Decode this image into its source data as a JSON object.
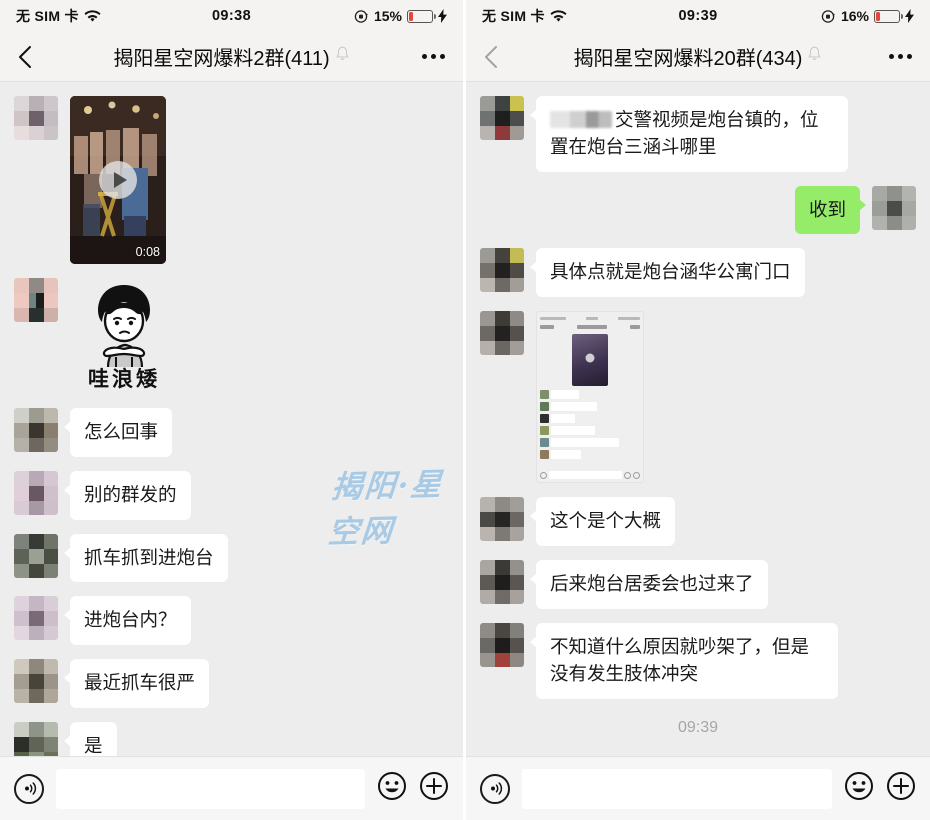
{
  "watermark": "揭阳·星空网",
  "colors": {
    "bubble_out": "#95EC69",
    "bubble_in": "#FFFFFF",
    "chat_bg": "#EDEDED",
    "battery_low": "#E8453C",
    "watermark": "#9DC4E4"
  },
  "panels": [
    {
      "status": {
        "carrier": "无 SIM 卡",
        "wifi_icon": "wifi-icon",
        "time": "09:38",
        "lock_icon": "rotation-lock-icon",
        "battery_percent": "15%",
        "battery_level": 15,
        "charging_icon": "lightning-bolt-icon"
      },
      "nav": {
        "back_icon": "chevron-left-icon",
        "title": "揭阳星空网爆料2群(411)",
        "mute_icon": "bell-muted-icon",
        "more_icon": "more-dots-icon"
      },
      "messages": [
        {
          "type": "video",
          "side": "in",
          "duration": "0:08",
          "play_icon": "play-icon"
        },
        {
          "type": "sticker",
          "side": "in",
          "caption": "哇浪矮",
          "alt": "cartoon-face-sticker"
        },
        {
          "type": "text",
          "side": "in",
          "text": "怎么回事"
        },
        {
          "type": "text",
          "side": "in",
          "text": "别的群发的"
        },
        {
          "type": "text",
          "side": "in",
          "text": "抓车抓到进炮台"
        },
        {
          "type": "text",
          "side": "in",
          "text": "进炮台内？"
        },
        {
          "type": "text",
          "side": "in",
          "text": "最近抓车很严"
        },
        {
          "type": "text",
          "side": "in",
          "text": "是"
        }
      ],
      "input": {
        "voice_icon": "voice-input-icon",
        "value": "",
        "placeholder": "",
        "emoji_icon": "smiley-icon",
        "plus_icon": "plus-icon"
      }
    },
    {
      "status": {
        "carrier": "无 SIM 卡",
        "wifi_icon": "wifi-icon",
        "time": "09:39",
        "lock_icon": "rotation-lock-icon",
        "battery_percent": "16%",
        "battery_level": 16,
        "charging_icon": "lightning-bolt-icon"
      },
      "nav": {
        "back_icon": "chevron-left-icon",
        "title": "揭阳星空网爆料20群(434)",
        "mute_icon": "bell-muted-icon",
        "more_icon": "more-dots-icon"
      },
      "messages": [
        {
          "type": "text",
          "side": "in",
          "redacted_name": true,
          "text": "交警视频是炮台镇的，位置在炮台三涵斗哪里"
        },
        {
          "type": "text",
          "side": "out",
          "text": "收到"
        },
        {
          "type": "text",
          "side": "in",
          "text": "具体点就是炮台涵华公寓门口"
        },
        {
          "type": "screenshot",
          "side": "in",
          "alt": "chat-screenshot-thumbnail"
        },
        {
          "type": "text",
          "side": "in",
          "text": "这个是个大概"
        },
        {
          "type": "text",
          "side": "in",
          "text": "后来炮台居委会也过来了"
        },
        {
          "type": "text",
          "side": "in",
          "text": "不知道什么原因就吵架了，但是没有发生肢体冲突"
        }
      ],
      "timestamp": "09:39",
      "input": {
        "voice_icon": "voice-input-icon",
        "value": "",
        "placeholder": "",
        "emoji_icon": "smiley-icon",
        "plus_icon": "plus-icon"
      }
    }
  ]
}
